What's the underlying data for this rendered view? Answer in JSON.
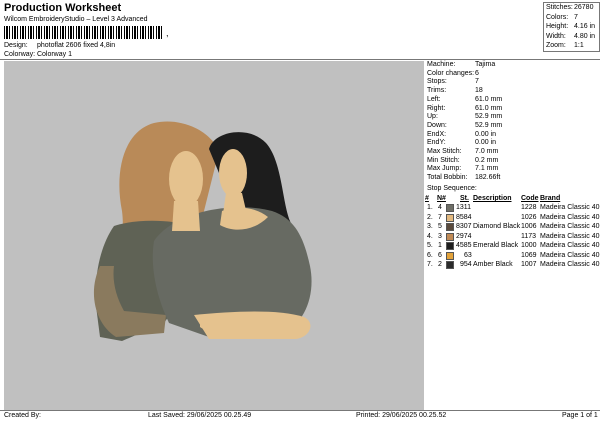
{
  "header": {
    "title": "Production Worksheet",
    "subtitle": "Wilcom EmbroideryStudio – Level 3 Advanced",
    "barcode_tail": ","
  },
  "design": {
    "label": "Design:",
    "value": "photoflat 2606 fixed 4,8in"
  },
  "colorway": {
    "label": "Colorway:",
    "value": "Colorway 1"
  },
  "stats": [
    {
      "label": "Stitches:",
      "value": "26780"
    },
    {
      "label": "Colors:",
      "value": "7"
    },
    {
      "label": "Height:",
      "value": "4.16 in"
    },
    {
      "label": "Width:",
      "value": "4.80 in"
    },
    {
      "label": "Zoom:",
      "value": "1:1"
    }
  ],
  "machine": [
    {
      "label": "Machine:",
      "value": "Tajima"
    },
    {
      "label": "Color changes:",
      "value": "6"
    },
    {
      "label": "Stops:",
      "value": "7"
    },
    {
      "label": "Trims:",
      "value": "18"
    },
    {
      "label": "Left:",
      "value": "61.0 mm"
    },
    {
      "label": "Right:",
      "value": "61.0 mm"
    },
    {
      "label": "Up:",
      "value": "52.9 mm"
    },
    {
      "label": "Down:",
      "value": "52.9 mm"
    },
    {
      "label": "EndX:",
      "value": "0.00 in"
    },
    {
      "label": "EndY:",
      "value": "0.00 in"
    },
    {
      "label": "Max Stitch:",
      "value": "7.0 mm"
    },
    {
      "label": "Min Stitch:",
      "value": "0.2 mm"
    },
    {
      "label": "Max Jump:",
      "value": "7.1 mm"
    },
    {
      "label": "Total Bobbin:",
      "value": "182.66ft"
    }
  ],
  "sequence": {
    "title": "Stop Sequence:",
    "headers": {
      "stop": "#",
      "n": "N#",
      "st": "St.",
      "desc": "Description",
      "code": "Code",
      "brand": "Brand"
    },
    "rows": [
      {
        "stop": "1.",
        "n": "4",
        "swatch": "#6e6e66",
        "st": "1311",
        "desc": "",
        "code": "1228",
        "brand": "Madeira Classic 40"
      },
      {
        "stop": "2.",
        "n": "7",
        "swatch": "#e3b97f",
        "st": "8584",
        "desc": "",
        "code": "1026",
        "brand": "Madeira Classic 40"
      },
      {
        "stop": "3.",
        "n": "5",
        "swatch": "#5a4a3c",
        "st": "8307",
        "desc": "Diamond Black",
        "code": "1006",
        "brand": "Madeira Classic 40"
      },
      {
        "stop": "4.",
        "n": "3",
        "swatch": "#c08a55",
        "st": "2974",
        "desc": "",
        "code": "1173",
        "brand": "Madeira Classic 40"
      },
      {
        "stop": "5.",
        "n": "1",
        "swatch": "#1e1e1e",
        "st": "4585",
        "desc": "Emerald Black",
        "code": "1000",
        "brand": "Madeira Classic 40"
      },
      {
        "stop": "6.",
        "n": "6",
        "swatch": "#e2a23a",
        "st": "63",
        "desc": "",
        "code": "1069",
        "brand": "Madeira Classic 40"
      },
      {
        "stop": "7.",
        "n": "2",
        "swatch": "#2b2b2b",
        "st": "954",
        "desc": "Amber Black",
        "code": "1007",
        "brand": "Madeira Classic 40"
      }
    ]
  },
  "footer": {
    "created": "Created By:",
    "saved": "Last Saved: 29/06/2025 00.25.49",
    "printed": "Printed: 29/06/2025 00.25.52",
    "page": "Page 1 of 1"
  }
}
